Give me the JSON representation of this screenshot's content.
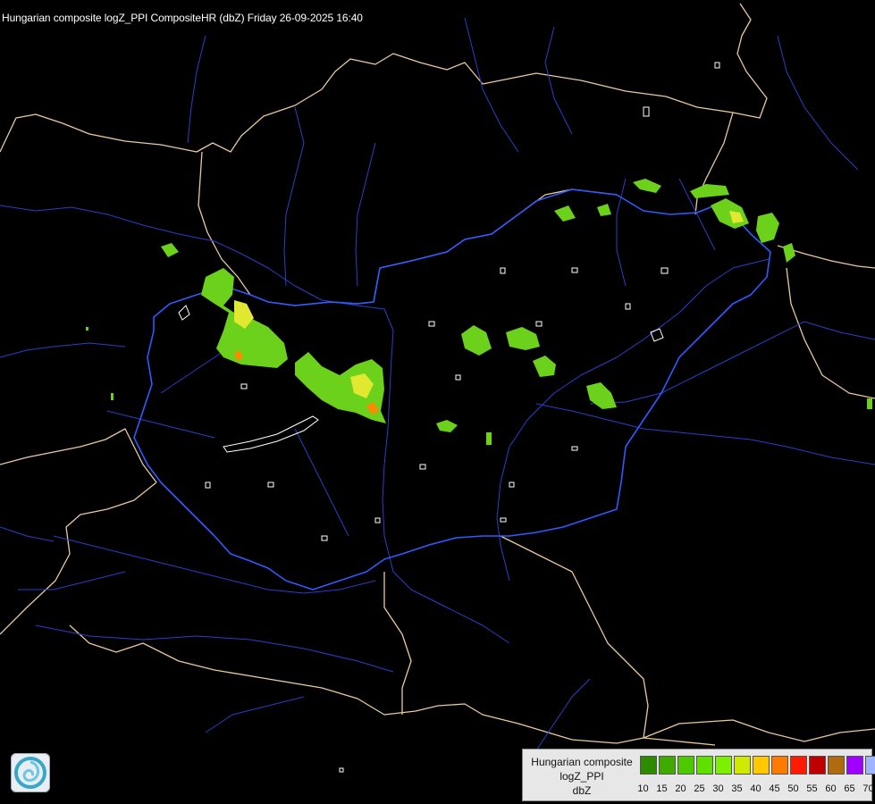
{
  "map": {
    "title": "Hungarian composite logZ_PPI CompositeHR (dbZ) Friday 26-09-2025 16:40",
    "colors": {
      "background": "#000000",
      "country_border": "#e8c9a0",
      "hungary_border": "#2f5bff",
      "rivers": "#2a3fc8",
      "lakes": "#ffffff",
      "echo_light": "#6bd11b",
      "echo_medium": "#8ef01c",
      "echo_strong": "#e0e830",
      "echo_core": "#ff8a00"
    }
  },
  "logo": {
    "icon": "met-service-swirl-icon"
  },
  "legend": {
    "line1": "Hungarian composite",
    "line2": "logZ_PPI",
    "line3": "dbZ",
    "scale": [
      {
        "value": "10",
        "color": "#2e8b00"
      },
      {
        "value": "15",
        "color": "#3fab00"
      },
      {
        "value": "20",
        "color": "#4cc900"
      },
      {
        "value": "25",
        "color": "#5fe000"
      },
      {
        "value": "30",
        "color": "#7cf000"
      },
      {
        "value": "35",
        "color": "#cfea00"
      },
      {
        "value": "40",
        "color": "#ffc800"
      },
      {
        "value": "45",
        "color": "#ff7a00"
      },
      {
        "value": "50",
        "color": "#ff1a00"
      },
      {
        "value": "55",
        "color": "#c00000"
      },
      {
        "value": "60",
        "color": "#b06a10"
      },
      {
        "value": "65",
        "color": "#a000ff"
      },
      {
        "value": "70",
        "color": "#a0b4ff"
      }
    ],
    "last_label": "70"
  }
}
